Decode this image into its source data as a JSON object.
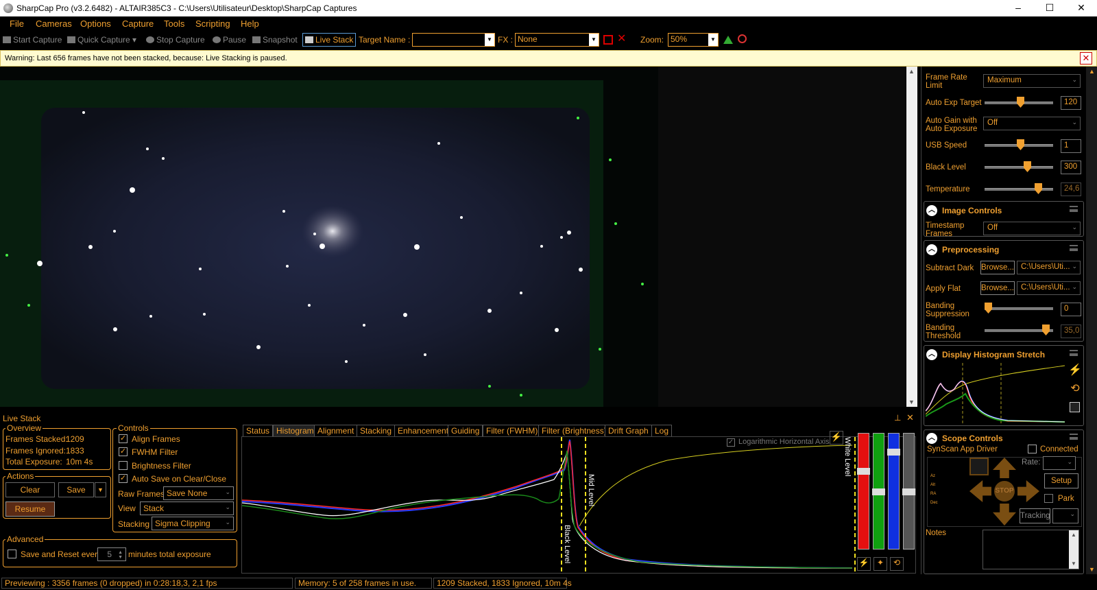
{
  "window": {
    "title": "SharpCap Pro (v3.2.6482) - ALTAIR385C3 - C:\\Users\\Utilisateur\\Desktop\\SharpCap Captures",
    "minimize": "–",
    "maximize": "☐",
    "close": "✕"
  },
  "menu": [
    "File",
    "Cameras",
    "Options",
    "Capture",
    "Tools",
    "Scripting",
    "Help"
  ],
  "toolbar": {
    "start_capture": "Start Capture",
    "quick_capture": "Quick Capture",
    "stop_capture": "Stop Capture",
    "pause": "Pause",
    "snapshot": "Snapshot",
    "live_stack": "Live Stack",
    "target_name_label": "Target Name :",
    "target_name_value": "",
    "fx_label": "FX :",
    "fx_value": "None",
    "zoom_label": "Zoom:",
    "zoom_value": "50%"
  },
  "warning": {
    "text": "Warning: Last 656 frames have not been stacked, because: Live Stacking is paused."
  },
  "camera_controls": {
    "frame_rate_limit_label": "Frame Rate Limit",
    "frame_rate_limit_value": "Maximum",
    "auto_exp_target_label": "Auto Exp Target",
    "auto_exp_target_value": "120",
    "auto_gain_label": "Auto Gain with Auto Exposure",
    "auto_gain_value": "Off",
    "usb_speed_label": "USB Speed",
    "usb_speed_value": "1",
    "black_level_label": "Black Level",
    "black_level_value": "300",
    "temperature_label": "Temperature",
    "temperature_value": "24,6"
  },
  "image_controls": {
    "header": "Image Controls",
    "timestamp_label": "Timestamp Frames",
    "timestamp_value": "Off"
  },
  "preprocessing": {
    "header": "Preprocessing",
    "subtract_dark_label": "Subtract Dark",
    "apply_flat_label": "Apply Flat",
    "browse_label": "Browse...",
    "dark_path": "C:\\Users\\Uti...",
    "flat_path": "C:\\Users\\Uti...",
    "banding_suppression_label": "Banding Suppression",
    "banding_suppression_value": "0",
    "banding_threshold_label": "Banding Threshold",
    "banding_threshold_value": "35,0"
  },
  "histogram_stretch": {
    "header": "Display Histogram Stretch"
  },
  "scope_controls": {
    "header": "Scope Controls",
    "driver": "SynScan App Driver",
    "connected_label": "Connected",
    "rate_label": "Rate:",
    "setup_label": "Setup",
    "stop_label": "STOP",
    "park_label": "Park",
    "tracking_label": "Tracking",
    "coord_labels": [
      "Az",
      "Alt",
      "RA",
      "Dec"
    ]
  },
  "notes": {
    "label": "Notes"
  },
  "live_stack": {
    "title": "Live Stack",
    "overview_label": "Overview",
    "frames_stacked_label": "Frames Stacked:",
    "frames_stacked_value": "1209",
    "frames_ignored_label": "Frames Ignored:",
    "frames_ignored_value": "1833",
    "total_exposure_label": "Total Exposure:",
    "total_exposure_value": "10m 4s",
    "actions_label": "Actions",
    "clear_label": "Clear",
    "save_label": "Save",
    "resume_label": "Resume",
    "controls_label": "Controls",
    "align_frames_label": "Align Frames",
    "fwhm_filter_label": "FWHM Filter",
    "brightness_filter_label": "Brightness Filter",
    "auto_save_label": "Auto Save on Clear/Close",
    "raw_frames_label": "Raw Frames",
    "raw_frames_value": "Save None",
    "view_label": "View",
    "view_value": "Stack",
    "stacking_label": "Stacking",
    "stacking_value": "Sigma Clipping",
    "advanced_label": "Advanced",
    "save_reset_label": "Save and Reset every",
    "save_reset_value": "5",
    "minutes_label": "minutes total exposure"
  },
  "tabs": [
    "Status",
    "Histogram",
    "Alignment",
    "Stacking",
    "Enhancement",
    "Guiding",
    "Filter (FWHM)",
    "Filter (Brightness)",
    "Drift Graph",
    "Log"
  ],
  "histogram": {
    "log_axis_label": "Logarithmic Horizontal Axis",
    "black_level_label": "Black Level",
    "mid_level_label": "Mid Level",
    "white_level_label": "White Level"
  },
  "status": {
    "preview": "Previewing : 3356 frames (0 dropped) in 0:28:18,3, 2,1 fps",
    "memory": "Memory: 5 of 258 frames in use.",
    "stack": "1209 Stacked, 1833 Ignored, 10m 4s"
  },
  "colors": {
    "accent": "#f0a030",
    "warning_bg": "#fffbd0"
  }
}
